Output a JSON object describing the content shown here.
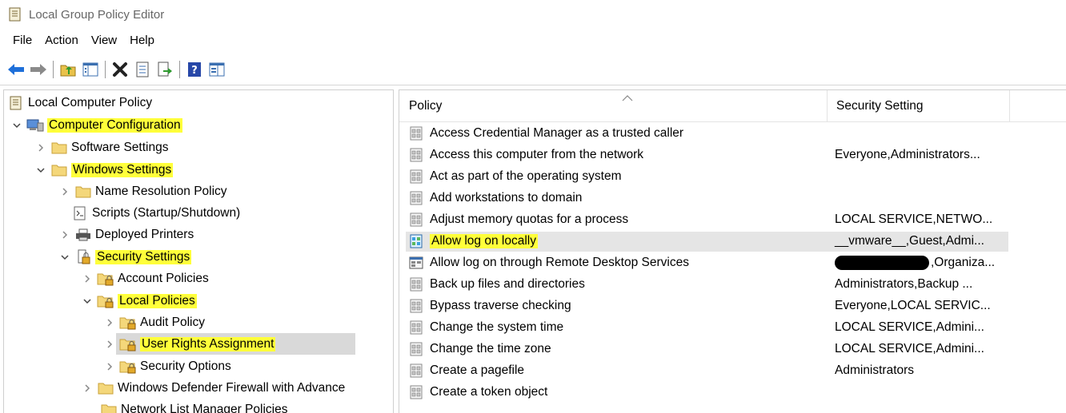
{
  "window": {
    "title": "Local Group Policy Editor",
    "app_icon": "policy-editor-icon"
  },
  "menubar": {
    "items": [
      "File",
      "Action",
      "View",
      "Help"
    ]
  },
  "toolbar": {
    "buttons": [
      "back-arrow-icon",
      "forward-arrow-icon",
      "up-folder-icon",
      "show-hide-tree-icon",
      "delete-icon",
      "properties-icon",
      "export-list-icon",
      "help-icon",
      "view-icon"
    ]
  },
  "tree": {
    "highlight_color": "#ffff3a",
    "nodes": [
      {
        "label": "Local Computer Policy",
        "icon": "policy-book-icon",
        "arrow": "none",
        "highlighted": false
      },
      {
        "label": "Computer Configuration",
        "icon": "computer-icon",
        "arrow": "expanded",
        "highlighted": true
      },
      {
        "label": "Software Settings",
        "icon": "folder-icon",
        "arrow": "collapsed",
        "highlighted": false
      },
      {
        "label": "Windows Settings",
        "icon": "folder-icon",
        "arrow": "expanded",
        "highlighted": true
      },
      {
        "label": "Name Resolution Policy",
        "icon": "folder-icon",
        "arrow": "collapsed",
        "highlighted": false
      },
      {
        "label": "Scripts (Startup/Shutdown)",
        "icon": "script-icon",
        "arrow": "none",
        "highlighted": false
      },
      {
        "label": "Deployed Printers",
        "icon": "printer-icon",
        "arrow": "collapsed",
        "highlighted": false
      },
      {
        "label": "Security Settings",
        "icon": "security-settings-icon",
        "arrow": "expanded",
        "highlighted": true
      },
      {
        "label": "Account Policies",
        "icon": "locked-folder-icon",
        "arrow": "collapsed",
        "highlighted": false
      },
      {
        "label": "Local Policies",
        "icon": "locked-folder-icon",
        "arrow": "expanded",
        "highlighted": true
      },
      {
        "label": "Audit Policy",
        "icon": "locked-folder-icon",
        "arrow": "collapsed",
        "highlighted": false
      },
      {
        "label": "User Rights Assignment",
        "icon": "locked-folder-icon",
        "arrow": "collapsed",
        "highlighted": true,
        "selected": true
      },
      {
        "label": "Security Options",
        "icon": "locked-folder-icon",
        "arrow": "collapsed",
        "highlighted": false
      },
      {
        "label": "Windows Defender Firewall with Advance",
        "icon": "folder-icon",
        "arrow": "collapsed",
        "highlighted": false
      },
      {
        "label": "Network List Manager Policies",
        "icon": "folder-icon",
        "arrow": "none",
        "highlighted": false
      }
    ]
  },
  "list": {
    "columns": [
      "Policy",
      "Security Setting"
    ],
    "rows": [
      {
        "policy": "Access Credential Manager as a trusted caller",
        "setting": "",
        "icon": "policy-setting-icon"
      },
      {
        "policy": "Access this computer from the network",
        "setting": "Everyone,Administrators...",
        "icon": "policy-setting-icon"
      },
      {
        "policy": "Act as part of the operating system",
        "setting": "",
        "icon": "policy-setting-icon"
      },
      {
        "policy": "Add workstations to domain",
        "setting": "",
        "icon": "policy-setting-icon"
      },
      {
        "policy": "Adjust memory quotas for a process",
        "setting": "LOCAL SERVICE,NETWO...",
        "icon": "policy-setting-icon"
      },
      {
        "policy": "Allow log on locally",
        "setting": "__vmware__,Guest,Admi...",
        "icon": "policy-setting-active-icon",
        "selected": true,
        "highlighted": true
      },
      {
        "policy": "Allow log on through Remote Desktop Services",
        "setting": ",Organiza...",
        "icon": "policy-setting-remote-icon",
        "redacted_prefix": true
      },
      {
        "policy": "Back up files and directories",
        "setting": "Administrators,Backup ...",
        "icon": "policy-setting-icon"
      },
      {
        "policy": "Bypass traverse checking",
        "setting": "Everyone,LOCAL SERVIC...",
        "icon": "policy-setting-icon"
      },
      {
        "policy": "Change the system time",
        "setting": "LOCAL SERVICE,Admini...",
        "icon": "policy-setting-icon"
      },
      {
        "policy": "Change the time zone",
        "setting": "LOCAL SERVICE,Admini...",
        "icon": "policy-setting-icon"
      },
      {
        "policy": "Create a pagefile",
        "setting": "Administrators",
        "icon": "policy-setting-icon"
      },
      {
        "policy": "Create a token object",
        "setting": "",
        "icon": "policy-setting-icon"
      }
    ]
  }
}
